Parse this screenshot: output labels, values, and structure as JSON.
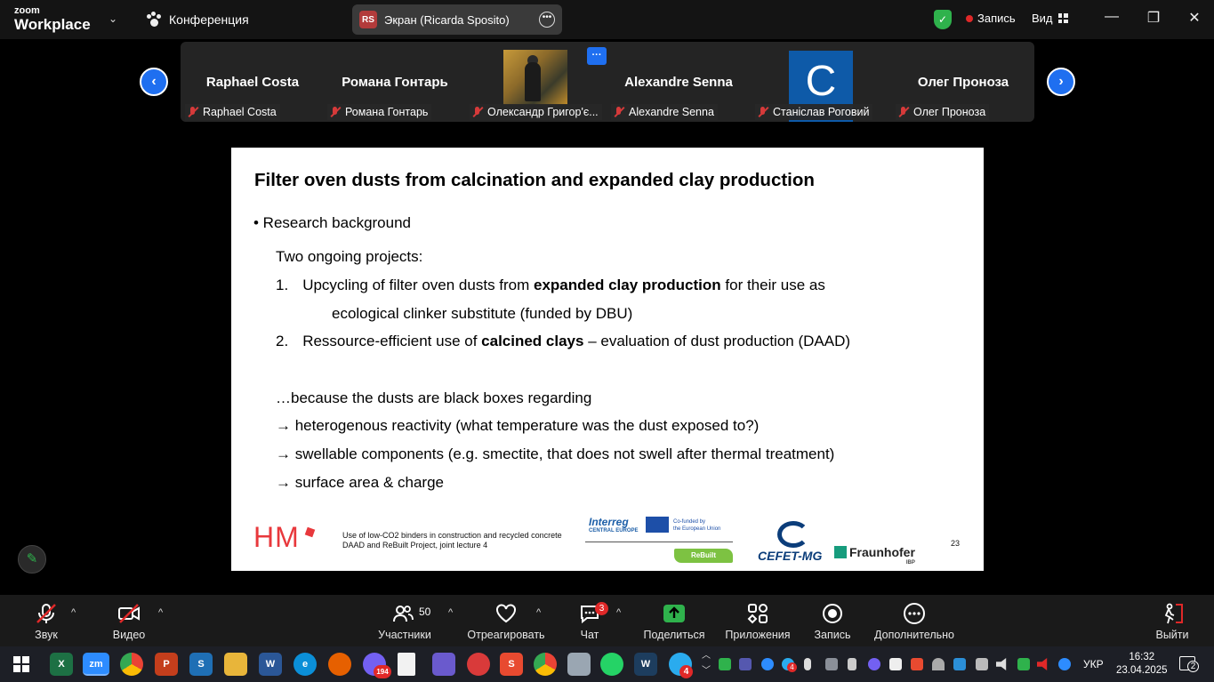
{
  "app": {
    "brand_top": "zoom",
    "brand_bottom": "Workplace",
    "conference_label": "Конференция",
    "screen_share_badge": "RS",
    "screen_share_title": "Экран (Ricarda Sposito)",
    "record_label": "Запись",
    "view_label": "Вид",
    "brand_color": "#1f6ff0"
  },
  "participants": [
    {
      "display": "Raphael Costa",
      "label": "Raphael Costa"
    },
    {
      "display": "Романа Гонтарь",
      "label": "Романа Гонтарь"
    },
    {
      "display": "",
      "label": "Олександр Григор'є..."
    },
    {
      "display": "Alexandre Senna",
      "label": "Alexandre Senna"
    },
    {
      "display": "C",
      "label": "Станіслав Роговий"
    },
    {
      "display": "Олег Проноза",
      "label": "Олег Проноза"
    }
  ],
  "more_button": "···",
  "slide": {
    "title": "Filter oven dusts from calcination and expanded clay production",
    "bullet": "• Research background",
    "intro": "Two ongoing projects:",
    "item1_num": "1.",
    "item1_pre": "Upcycling of filter oven dusts from ",
    "item1_bold": "expanded clay production",
    "item1_post": " for their use as",
    "item1_cont": "ecological clinker substitute (funded by DBU)",
    "item2_num": "2.",
    "item2_pre": "Ressource-efficient use of ",
    "item2_bold": "calcined clays",
    "item2_post": " – evaluation of dust production (DAAD)",
    "because": "…because the dusts are black boxes regarding",
    "arrow1": "→ heterogenous reactivity (what temperature was the dust exposed to?)",
    "arrow2": "→ swellable components (e.g. smectite, that does not swell after thermal treatment)",
    "arrow3": "→ surface area & charge",
    "footer_logo": "HM",
    "footer_line1": "Use of low-CO2 binders in construction and recycled concrete",
    "footer_line2": "DAAD and ReBuilt Project, joint lecture 4",
    "interreg": "Interreg",
    "interreg_sub": "CENTRAL EUROPE",
    "eu_text_1": "Co-funded by",
    "eu_text_2": "the European Union",
    "rebuilt": "ReBuilt",
    "cefet": "CEFET-MG",
    "fraunhofer": "Fraunhofer",
    "fraunhofer_sub": "IBP",
    "page": "23"
  },
  "toolbar": {
    "audio": "Звук",
    "video": "Видео",
    "participants": "Участники",
    "participants_count": "50",
    "react": "Отреагировать",
    "chat": "Чат",
    "chat_badge": "3",
    "share": "Поделиться",
    "apps": "Приложения",
    "record": "Запись",
    "more": "Дополнительно",
    "leave": "Выйти"
  },
  "taskbar": {
    "viber_badge": "194",
    "telegram_badge": "4",
    "tray_badge": "4",
    "lang": "УКР",
    "time": "16:32",
    "date": "23.04.2025",
    "notifications": "2"
  }
}
